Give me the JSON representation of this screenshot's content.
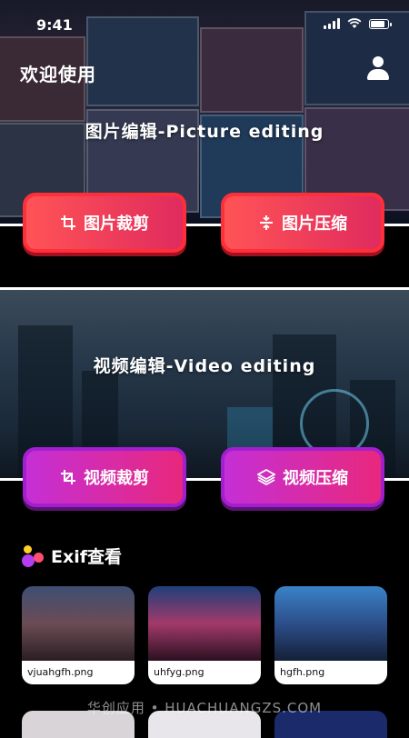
{
  "status": {
    "time": "9:41"
  },
  "header": {
    "welcome": "欢迎使用"
  },
  "picture": {
    "title": "图片编辑-Picture editing",
    "crop_label": "图片裁剪",
    "compress_label": "图片压缩"
  },
  "video": {
    "title": "视频编辑-Video editing",
    "crop_label": "视频裁剪",
    "compress_label": "视频压缩"
  },
  "exif": {
    "title": "Exif查看",
    "items": [
      {
        "name": "vjuahgfh.png"
      },
      {
        "name": "uhfyg.png"
      },
      {
        "name": "hgfh.png"
      }
    ]
  },
  "watermark": "华创应用 • HUACHUANGZS.COM",
  "colors": {
    "red_button": "#ff4d57",
    "purple_button": "#c52fd6",
    "background": "#000000"
  },
  "icons": [
    "signal-icon",
    "wifi-icon",
    "battery-icon",
    "user-icon",
    "crop-icon",
    "compress-icon",
    "layers-icon",
    "exif-dots-icon"
  ]
}
